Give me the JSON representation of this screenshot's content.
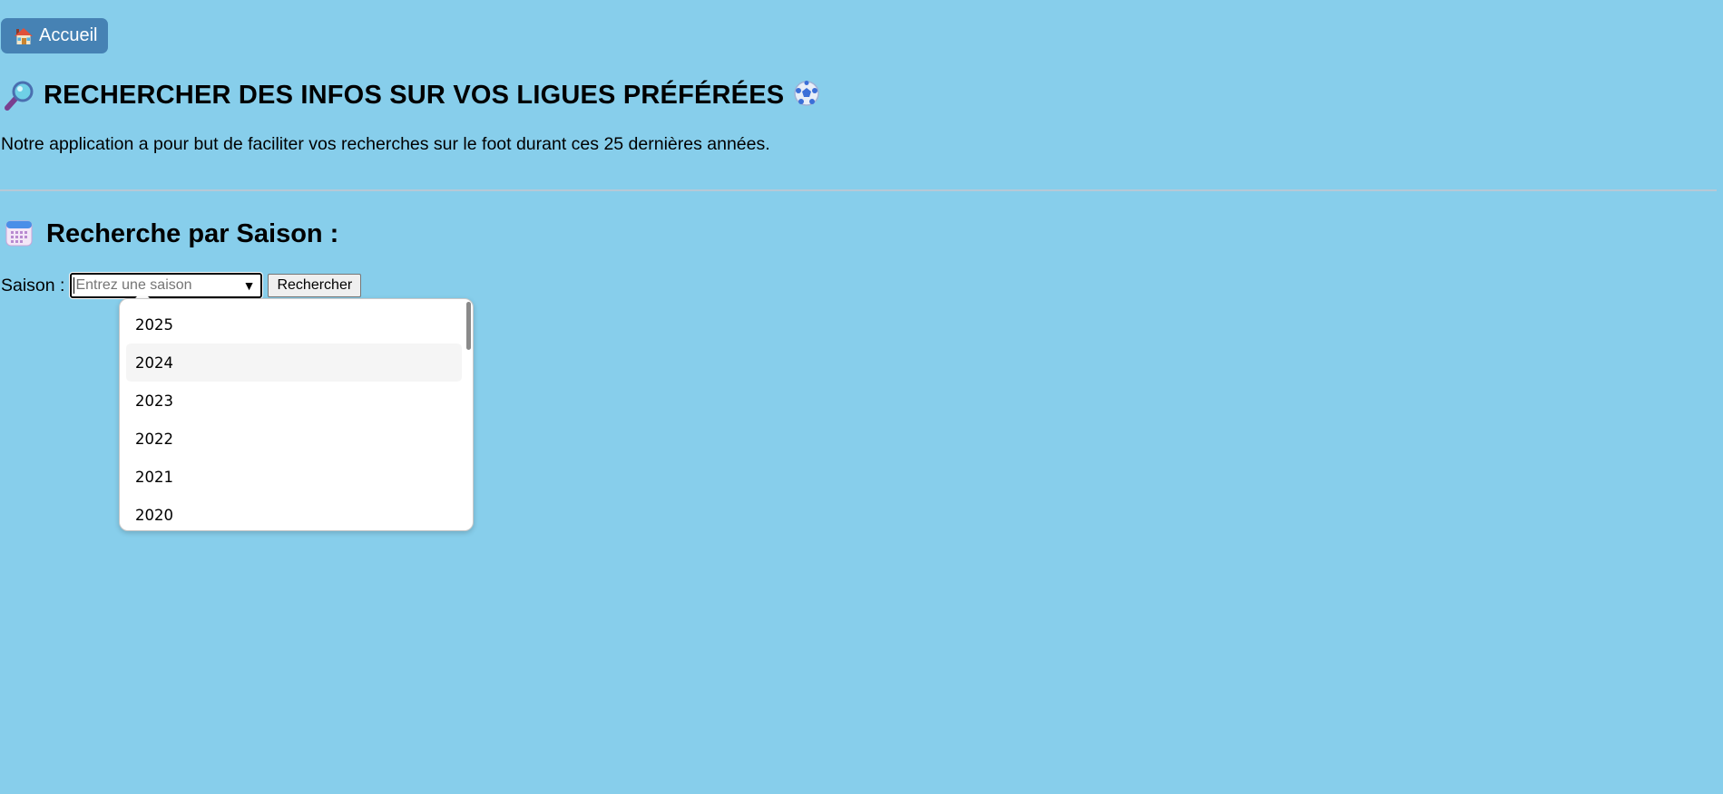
{
  "header": {
    "home_label": "Accueil",
    "home_icon": "house-icon"
  },
  "main": {
    "title": "RECHERCHER DES INFOS SUR VOS LIGUES PRÉFÉRÉES",
    "title_icons": [
      "magnifier-icon",
      "soccer-ball-icon"
    ],
    "intro": "Notre application a pour but de faciliter vos recherches sur le foot durant ces 25 dernières années."
  },
  "season_search": {
    "title": "Recherche par Saison :",
    "title_icon": "calendar-icon",
    "label": "Saison :",
    "placeholder": "Entrez une saison",
    "value": "",
    "button_label": "Rechercher",
    "options": [
      "2025",
      "2024",
      "2023",
      "2022",
      "2021",
      "2020"
    ],
    "hovered_option": "2024"
  },
  "colors": {
    "background": "#87ceeb",
    "home_button": "#4682b4",
    "divider": "#b7c9d6"
  }
}
